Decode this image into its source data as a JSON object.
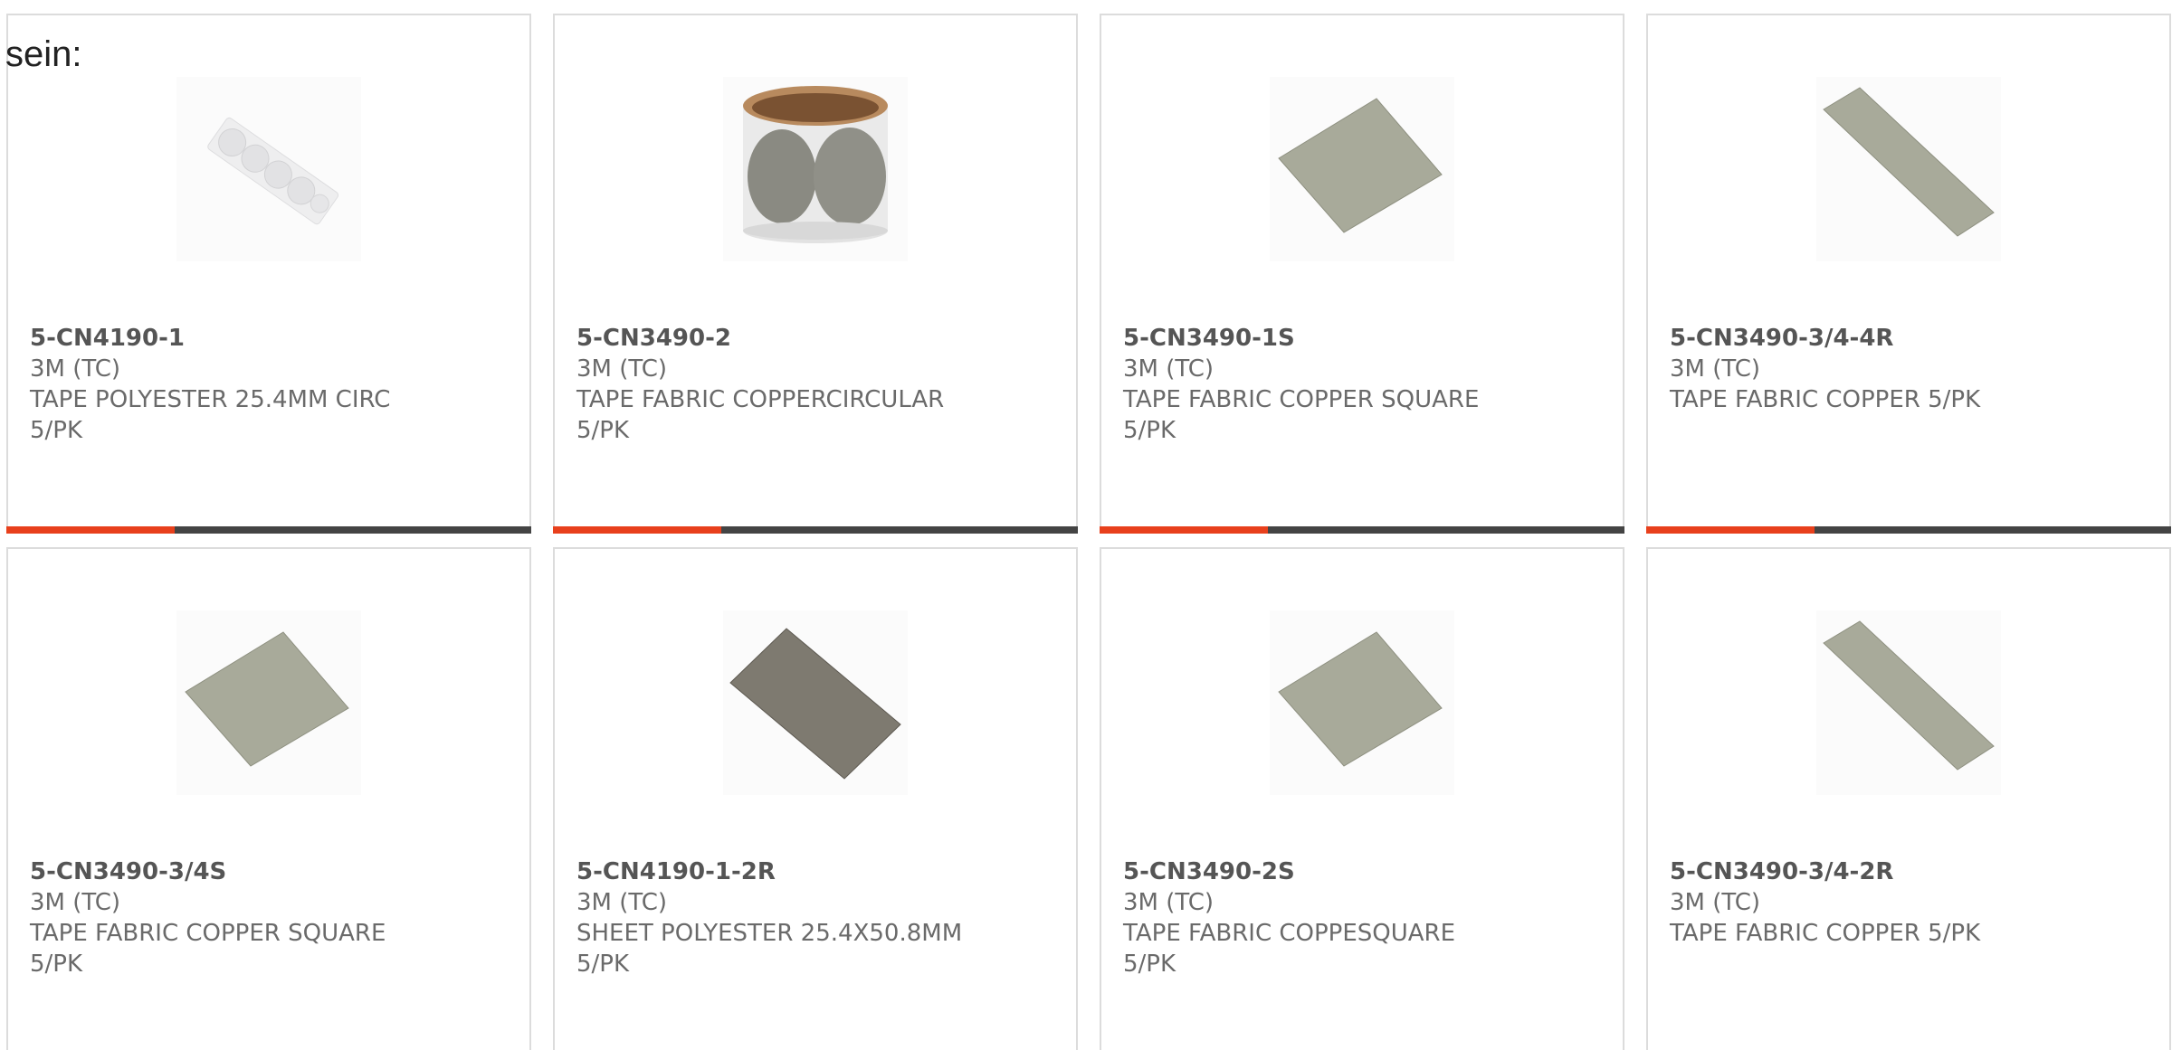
{
  "intro_text": "sein:",
  "colors": {
    "accent": "#e8401c",
    "bar_track": "#444444",
    "card_border": "#dcdcdc",
    "text": "#6a6a6a"
  },
  "products": [
    {
      "part_number": "5-CN4190-1",
      "manufacturer": "3M (TC)",
      "description_line1": "TAPE POLYESTER 25.4MM CIRC",
      "description_line2": "5/PK",
      "image": "dot-strip-image",
      "bar_progress": 0.32
    },
    {
      "part_number": "5-CN3490-2",
      "manufacturer": "3M (TC)",
      "description_line1": "TAPE FABRIC COPPERCIRCULAR",
      "description_line2": "5/PK",
      "image": "circle-roll-image",
      "bar_progress": 0.32
    },
    {
      "part_number": "5-CN3490-1S",
      "manufacturer": "3M (TC)",
      "description_line1": "TAPE FABRIC COPPER SQUARE",
      "description_line2": "5/PK",
      "image": "square-sheet-image",
      "bar_progress": 0.32
    },
    {
      "part_number": "5-CN3490-3/4-4R",
      "manufacturer": "3M (TC)",
      "description_line1": "TAPE FABRIC COPPER 5/PK",
      "description_line2": "",
      "image": "strip-image",
      "bar_progress": 0.32
    },
    {
      "part_number": "5-CN3490-3/4S",
      "manufacturer": "3M (TC)",
      "description_line1": "TAPE FABRIC COPPER SQUARE",
      "description_line2": "5/PK",
      "image": "square-sheet-image"
    },
    {
      "part_number": "5-CN4190-1-2R",
      "manufacturer": "3M (TC)",
      "description_line1": "SHEET POLYESTER 25.4X50.8MM",
      "description_line2": "5/PK",
      "image": "dark-sheet-image"
    },
    {
      "part_number": "5-CN3490-2S",
      "manufacturer": "3M (TC)",
      "description_line1": "TAPE FABRIC COPPESQUARE",
      "description_line2": "5/PK",
      "image": "square-sheet-image"
    },
    {
      "part_number": "5-CN3490-3/4-2R",
      "manufacturer": "3M (TC)",
      "description_line1": "TAPE FABRIC COPPER 5/PK",
      "description_line2": "",
      "image": "strip-image"
    }
  ]
}
